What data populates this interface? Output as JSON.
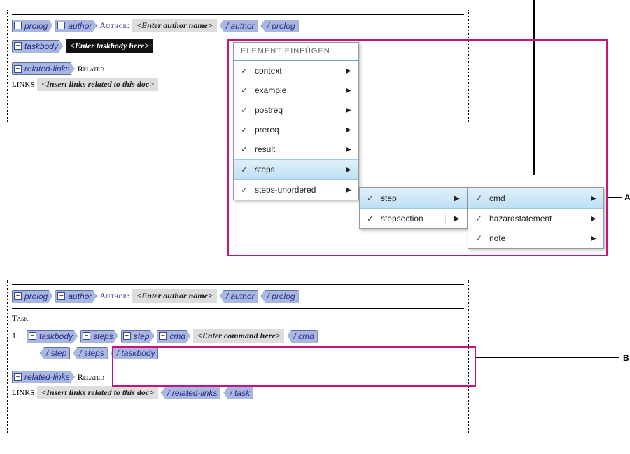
{
  "tags": {
    "prolog_open": "prolog",
    "prolog_close": "/ prolog",
    "author_open": "author",
    "author_close": "/ author",
    "taskbody_open": "taskbody",
    "taskbody_close": "/ taskbody",
    "relatedlinks_open": "related-links",
    "relatedlinks_close": "/ related-links",
    "steps_open": "steps",
    "steps_close": "/ steps",
    "step_open": "step",
    "step_close": "/ step",
    "cmd_open": "cmd",
    "cmd_close": "/ cmd",
    "task_close": "/ task"
  },
  "labels": {
    "author": "Author:",
    "related": "Related",
    "links": "links",
    "task": "Task"
  },
  "placeholders": {
    "author_name": "<Enter author name>",
    "taskbody": "<Enter taskbody here>",
    "links": "<Insert links related to this doc>",
    "cmd": "<Enter command here>"
  },
  "menu": {
    "title": "Element einfügen",
    "items": [
      {
        "label": "context"
      },
      {
        "label": "example"
      },
      {
        "label": "postreq"
      },
      {
        "label": "prereq"
      },
      {
        "label": "result"
      },
      {
        "label": "steps",
        "hilite": true
      },
      {
        "label": "steps-unordered"
      }
    ],
    "sub1": [
      {
        "label": "step",
        "hilite": true
      },
      {
        "label": "stepsection"
      }
    ],
    "sub2": [
      {
        "label": "cmd",
        "hilite": true
      },
      {
        "label": "hazardstatement"
      },
      {
        "label": "note"
      }
    ]
  },
  "callouts": {
    "a": "A",
    "b": "B"
  },
  "list_number": "1.",
  "toggle_glyph": "−"
}
